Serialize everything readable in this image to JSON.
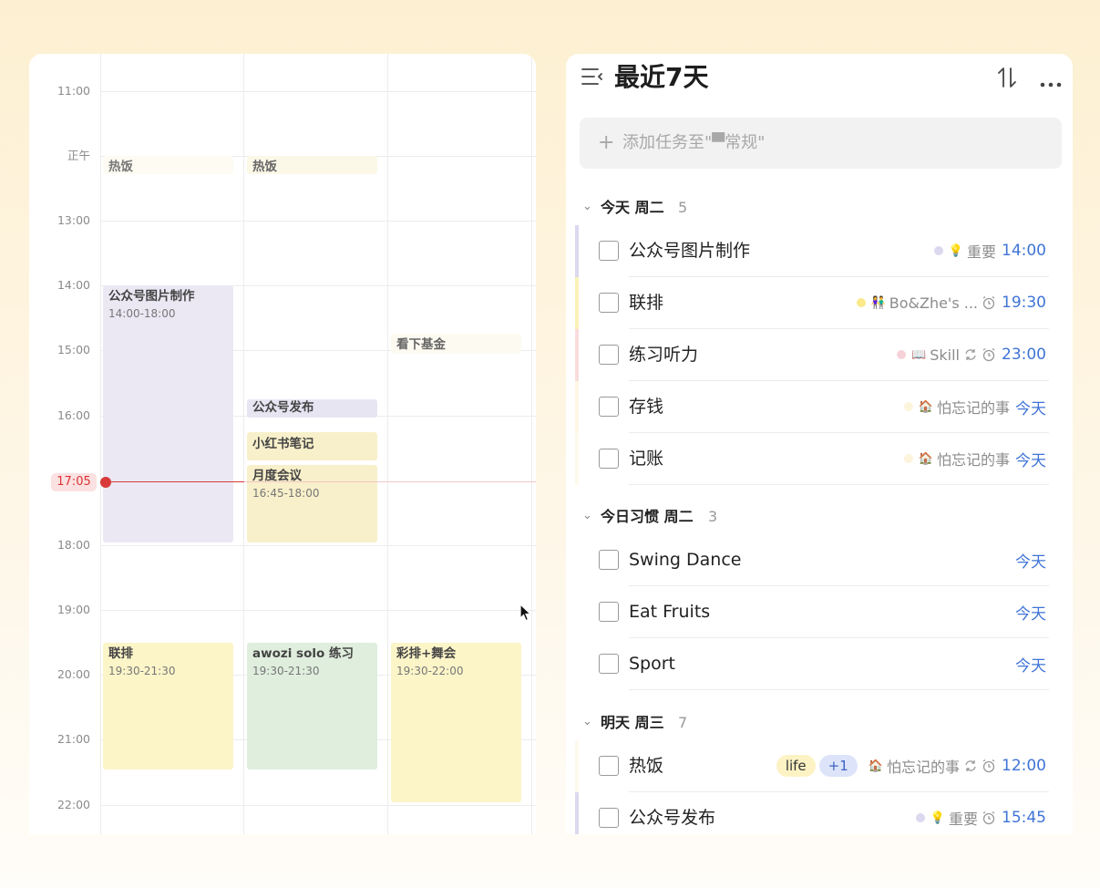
{
  "calendar": {
    "time_labels": [
      "11:00",
      "正午",
      "13:00",
      "14:00",
      "15:00",
      "16:00",
      "18:00",
      "19:00",
      "20:00",
      "21:00",
      "22:00"
    ],
    "now_label": "17:05",
    "events": [
      {
        "title": "热饭",
        "time": ""
      },
      {
        "title": "热饭",
        "time": ""
      },
      {
        "title": "公众号图片制作",
        "time": "14:00-18:00"
      },
      {
        "title": "看下基金",
        "time": ""
      },
      {
        "title": "公众号发布",
        "time": ""
      },
      {
        "title": "小红书笔记",
        "time": ""
      },
      {
        "title": "月度会议",
        "time": "16:45-18:00"
      },
      {
        "title": "联排",
        "time": "19:30-21:30"
      },
      {
        "title": "awozi solo 练习",
        "time": "19:30-21:30"
      },
      {
        "title": "彩排+舞会",
        "time": "19:30-22:00"
      }
    ]
  },
  "tasks": {
    "title": "最近7天",
    "add_placeholder": "添加任务至\"▀常规\"",
    "sections": [
      {
        "title": "今天 周二",
        "count": "5",
        "rows": [
          {
            "title": "公众号图片制作",
            "tag": "重要",
            "due": "14:00"
          },
          {
            "title": "联排",
            "tag": "Bo&Zhe's ...",
            "due": "19:30"
          },
          {
            "title": "练习听力",
            "tag": "Skill",
            "due": "23:00"
          },
          {
            "title": "存钱",
            "tag": "怕忘记的事",
            "due": "今天"
          },
          {
            "title": "记账",
            "tag": "怕忘记的事",
            "due": "今天"
          }
        ]
      },
      {
        "title": "今日习惯 周二",
        "count": "3",
        "rows": [
          {
            "title": "Swing Dance",
            "due": "今天"
          },
          {
            "title": "Eat Fruits",
            "due": "今天"
          },
          {
            "title": "Sport",
            "due": "今天"
          }
        ]
      },
      {
        "title": "明天 周三",
        "count": "7",
        "rows": [
          {
            "title": "热饭",
            "label": "life",
            "extra": "+1",
            "tag": "怕忘记的事",
            "due": "12:00"
          },
          {
            "title": "公众号发布",
            "tag": "重要",
            "due": "15:45"
          }
        ]
      }
    ]
  },
  "colors": {
    "accent_blue": "#3f74d6",
    "now_red": "#d83a3a",
    "event_lavender": "#ebe8f4",
    "event_yellow": "#fbf3c9",
    "event_green": "#dfeedd",
    "event_cream": "#fdfaee"
  },
  "icons": [
    "list-menu-icon",
    "sort-icon",
    "more-icon",
    "plus-icon",
    "checkbox-icon",
    "alarm-icon",
    "repeat-icon",
    "chevron-down-icon",
    "lightbulb-icon",
    "people-icon",
    "book-icon",
    "house-icon",
    "cursor-icon"
  ]
}
